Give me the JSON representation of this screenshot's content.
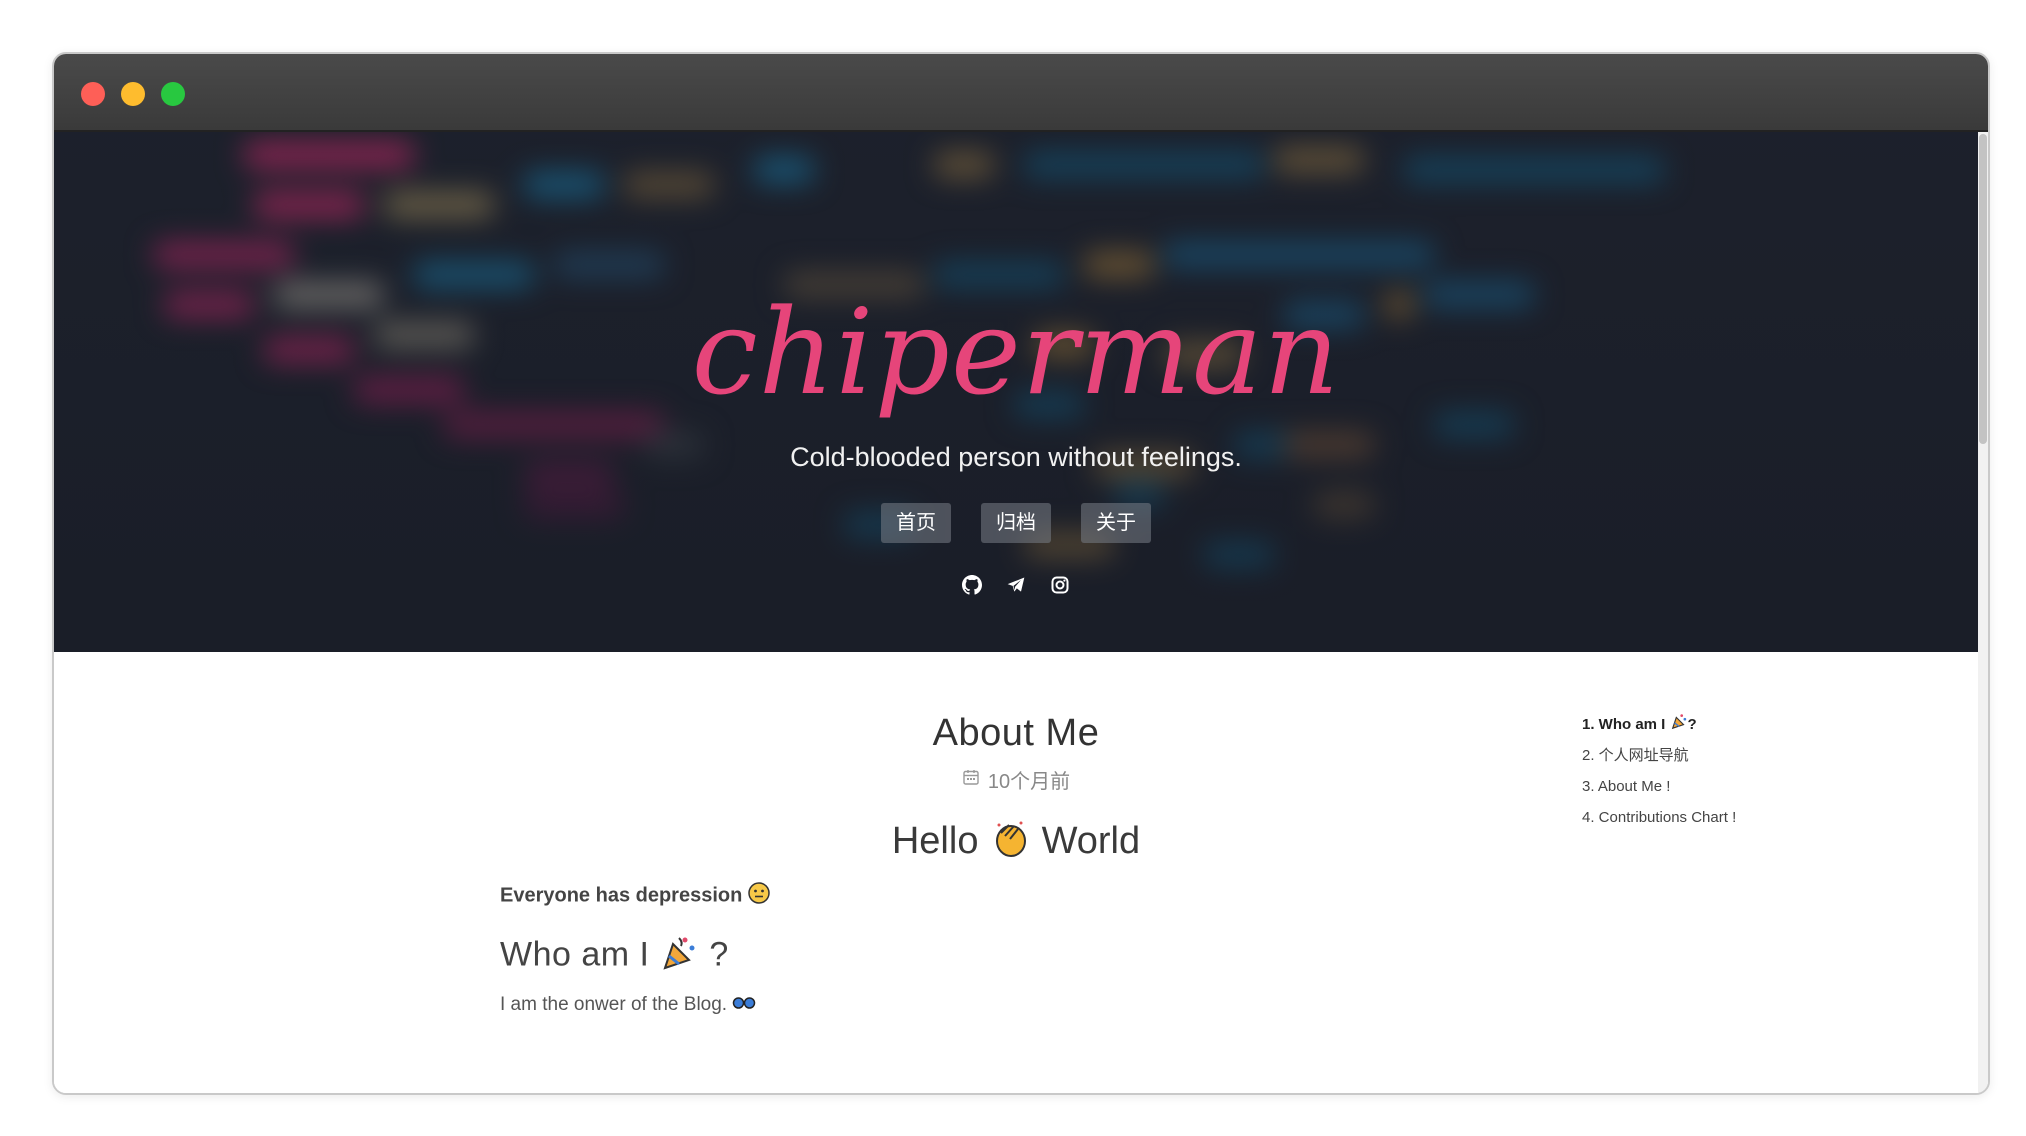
{
  "hero": {
    "brand": "chiperman",
    "subtitle": "Cold-blooded person without feelings.",
    "nav": [
      "首页",
      "归档",
      "关于"
    ],
    "social_icons": [
      "github-icon",
      "telegram-icon",
      "instagram-icon"
    ]
  },
  "post": {
    "title": "About Me",
    "meta_time": "10个月前",
    "h1_before": "Hello",
    "h1_after": "World",
    "emphasis": "Everyone has depression",
    "h2_text": "Who am I",
    "h2_suffix": "?",
    "paragraph": "I am the onwer of the Blog."
  },
  "toc": {
    "items": [
      {
        "text": "1. Who am I",
        "suffix": "?"
      },
      {
        "text": "2. 个人网址导航"
      },
      {
        "text": "3. About Me !"
      },
      {
        "text": "4. Contributions Chart !"
      }
    ]
  },
  "colors": {
    "brand": "#e6457a",
    "hero_bg": "#1f2430",
    "nav_bg": "#787d87"
  }
}
